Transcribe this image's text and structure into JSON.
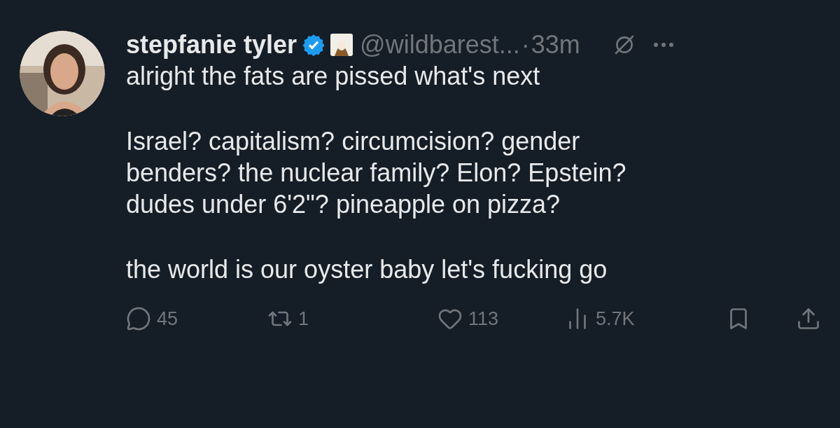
{
  "post": {
    "author": "stepfanie tyler",
    "verified": true,
    "handle": "@wildbarest...",
    "separator": "·",
    "time": "33m",
    "paragraphs": [
      [
        "alright the fats are pissed what's next"
      ],
      [
        "Israel? capitalism? circumcision? gender",
        "benders? the nuclear family? Elon? Epstein?",
        "dudes under 6'2\"? pineapple on pizza?"
      ],
      [
        "the world is our oyster baby let's fucking go"
      ]
    ],
    "actions": [
      {
        "kind": "reply",
        "count": "45"
      },
      {
        "kind": "repost",
        "count": "1"
      },
      {
        "kind": "like",
        "count": "113"
      },
      {
        "kind": "views",
        "count": "5.7K"
      },
      {
        "kind": "bookmark"
      },
      {
        "kind": "share"
      }
    ]
  }
}
